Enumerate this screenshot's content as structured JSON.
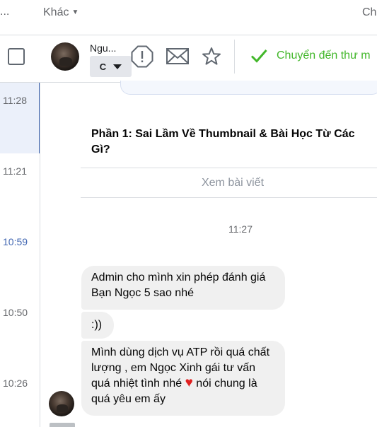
{
  "topbar": {
    "ellipsis": "...",
    "khac_label": "Khác",
    "right_label": "Ch"
  },
  "toolbar": {
    "sender_name": "Ngu...",
    "label_value": "C",
    "move_label": "Chuyển đến thư m",
    "icons": [
      "spam-report-icon",
      "mail-icon",
      "star-icon",
      "check-icon"
    ]
  },
  "left_times": [
    {
      "label": "11:28",
      "active": false
    },
    {
      "label": "11:21",
      "active": false
    },
    {
      "label": "10:59",
      "active": true
    },
    {
      "label": "10:50",
      "active": false
    },
    {
      "label": "10:26",
      "active": false
    }
  ],
  "conversation": {
    "post_title_line1": "Phần 1: Sai Lầm Về Thumbnail & Bài Học Từ Các",
    "post_title_line2": "Gì?",
    "post_link": "Xem bài viết",
    "divider_time": "11:27",
    "messages": [
      {
        "text": "Admin cho mình xin phép đánh giá Bạn Ngọc 5 sao nhé"
      },
      {
        "text": ":))"
      },
      {
        "text_before": "Mình dùng dịch vụ ATP rồi quá chất lượng , em Ngọc Xinh gái tư vấn quá nhiệt tình nhé",
        "emoji": "♥",
        "text_after": "nói chung là quá yêu em ấy"
      }
    ]
  },
  "colors": {
    "accent_blue": "#4267b2",
    "green": "#42b72a",
    "bubble": "#f0f0f0",
    "heart": "#e02020"
  }
}
